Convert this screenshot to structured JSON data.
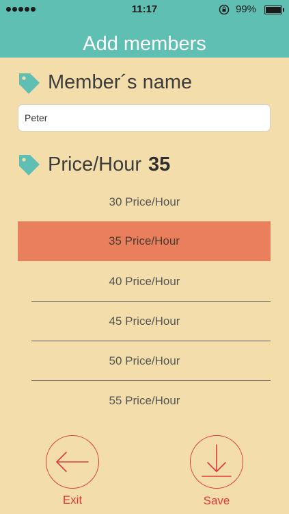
{
  "status_bar": {
    "time": "11:17",
    "battery": "99%",
    "signal_dots": 5
  },
  "nav": {
    "title": "Add members"
  },
  "member_name": {
    "label": "Member´s name",
    "value": "Peter"
  },
  "price": {
    "label": "Price/Hour",
    "value": "35"
  },
  "picker": {
    "options": [
      "30 Price/Hour",
      "35 Price/Hour",
      "40 Price/Hour",
      "45 Price/Hour",
      "50 Price/Hour",
      "55 Price/Hour"
    ],
    "selected_index": 1
  },
  "actions": {
    "exit_label": "Exit",
    "save_label": "Save"
  },
  "colors": {
    "accent_teal": "#5fbfb3",
    "background": "#f3deab",
    "selected_row": "#e97f5c",
    "action_red": "#e0383a"
  },
  "icons": {
    "tag": "tag-icon",
    "exit": "arrow-left-icon",
    "save": "download-icon",
    "lock": "rotation-lock-icon",
    "battery": "battery-icon"
  }
}
